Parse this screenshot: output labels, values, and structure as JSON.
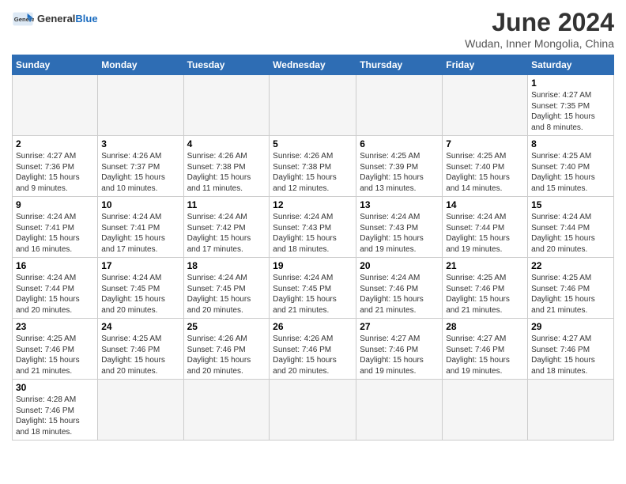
{
  "header": {
    "logo_text_regular": "General",
    "logo_text_blue": "Blue",
    "month_title": "June 2024",
    "subtitle": "Wudan, Inner Mongolia, China"
  },
  "days_of_week": [
    "Sunday",
    "Monday",
    "Tuesday",
    "Wednesday",
    "Thursday",
    "Friday",
    "Saturday"
  ],
  "weeks": [
    [
      {
        "day": null,
        "info": null
      },
      {
        "day": null,
        "info": null
      },
      {
        "day": null,
        "info": null
      },
      {
        "day": null,
        "info": null
      },
      {
        "day": null,
        "info": null
      },
      {
        "day": null,
        "info": null
      },
      {
        "day": "1",
        "info": "Sunrise: 4:27 AM\nSunset: 7:35 PM\nDaylight: 15 hours\nand 8 minutes."
      }
    ],
    [
      {
        "day": "2",
        "info": "Sunrise: 4:27 AM\nSunset: 7:36 PM\nDaylight: 15 hours\nand 9 minutes."
      },
      {
        "day": "3",
        "info": "Sunrise: 4:26 AM\nSunset: 7:37 PM\nDaylight: 15 hours\nand 10 minutes."
      },
      {
        "day": "4",
        "info": "Sunrise: 4:26 AM\nSunset: 7:38 PM\nDaylight: 15 hours\nand 11 minutes."
      },
      {
        "day": "5",
        "info": "Sunrise: 4:26 AM\nSunset: 7:38 PM\nDaylight: 15 hours\nand 12 minutes."
      },
      {
        "day": "6",
        "info": "Sunrise: 4:25 AM\nSunset: 7:39 PM\nDaylight: 15 hours\nand 13 minutes."
      },
      {
        "day": "7",
        "info": "Sunrise: 4:25 AM\nSunset: 7:40 PM\nDaylight: 15 hours\nand 14 minutes."
      },
      {
        "day": "8",
        "info": "Sunrise: 4:25 AM\nSunset: 7:40 PM\nDaylight: 15 hours\nand 15 minutes."
      }
    ],
    [
      {
        "day": "9",
        "info": "Sunrise: 4:24 AM\nSunset: 7:41 PM\nDaylight: 15 hours\nand 16 minutes."
      },
      {
        "day": "10",
        "info": "Sunrise: 4:24 AM\nSunset: 7:41 PM\nDaylight: 15 hours\nand 17 minutes."
      },
      {
        "day": "11",
        "info": "Sunrise: 4:24 AM\nSunset: 7:42 PM\nDaylight: 15 hours\nand 17 minutes."
      },
      {
        "day": "12",
        "info": "Sunrise: 4:24 AM\nSunset: 7:43 PM\nDaylight: 15 hours\nand 18 minutes."
      },
      {
        "day": "13",
        "info": "Sunrise: 4:24 AM\nSunset: 7:43 PM\nDaylight: 15 hours\nand 19 minutes."
      },
      {
        "day": "14",
        "info": "Sunrise: 4:24 AM\nSunset: 7:44 PM\nDaylight: 15 hours\nand 19 minutes."
      },
      {
        "day": "15",
        "info": "Sunrise: 4:24 AM\nSunset: 7:44 PM\nDaylight: 15 hours\nand 20 minutes."
      }
    ],
    [
      {
        "day": "16",
        "info": "Sunrise: 4:24 AM\nSunset: 7:44 PM\nDaylight: 15 hours\nand 20 minutes."
      },
      {
        "day": "17",
        "info": "Sunrise: 4:24 AM\nSunset: 7:45 PM\nDaylight: 15 hours\nand 20 minutes."
      },
      {
        "day": "18",
        "info": "Sunrise: 4:24 AM\nSunset: 7:45 PM\nDaylight: 15 hours\nand 20 minutes."
      },
      {
        "day": "19",
        "info": "Sunrise: 4:24 AM\nSunset: 7:45 PM\nDaylight: 15 hours\nand 21 minutes."
      },
      {
        "day": "20",
        "info": "Sunrise: 4:24 AM\nSunset: 7:46 PM\nDaylight: 15 hours\nand 21 minutes."
      },
      {
        "day": "21",
        "info": "Sunrise: 4:25 AM\nSunset: 7:46 PM\nDaylight: 15 hours\nand 21 minutes."
      },
      {
        "day": "22",
        "info": "Sunrise: 4:25 AM\nSunset: 7:46 PM\nDaylight: 15 hours\nand 21 minutes."
      }
    ],
    [
      {
        "day": "23",
        "info": "Sunrise: 4:25 AM\nSunset: 7:46 PM\nDaylight: 15 hours\nand 21 minutes."
      },
      {
        "day": "24",
        "info": "Sunrise: 4:25 AM\nSunset: 7:46 PM\nDaylight: 15 hours\nand 20 minutes."
      },
      {
        "day": "25",
        "info": "Sunrise: 4:26 AM\nSunset: 7:46 PM\nDaylight: 15 hours\nand 20 minutes."
      },
      {
        "day": "26",
        "info": "Sunrise: 4:26 AM\nSunset: 7:46 PM\nDaylight: 15 hours\nand 20 minutes."
      },
      {
        "day": "27",
        "info": "Sunrise: 4:27 AM\nSunset: 7:46 PM\nDaylight: 15 hours\nand 19 minutes."
      },
      {
        "day": "28",
        "info": "Sunrise: 4:27 AM\nSunset: 7:46 PM\nDaylight: 15 hours\nand 19 minutes."
      },
      {
        "day": "29",
        "info": "Sunrise: 4:27 AM\nSunset: 7:46 PM\nDaylight: 15 hours\nand 18 minutes."
      }
    ],
    [
      {
        "day": "30",
        "info": "Sunrise: 4:28 AM\nSunset: 7:46 PM\nDaylight: 15 hours\nand 18 minutes."
      },
      {
        "day": null,
        "info": null
      },
      {
        "day": null,
        "info": null
      },
      {
        "day": null,
        "info": null
      },
      {
        "day": null,
        "info": null
      },
      {
        "day": null,
        "info": null
      },
      {
        "day": null,
        "info": null
      }
    ]
  ]
}
